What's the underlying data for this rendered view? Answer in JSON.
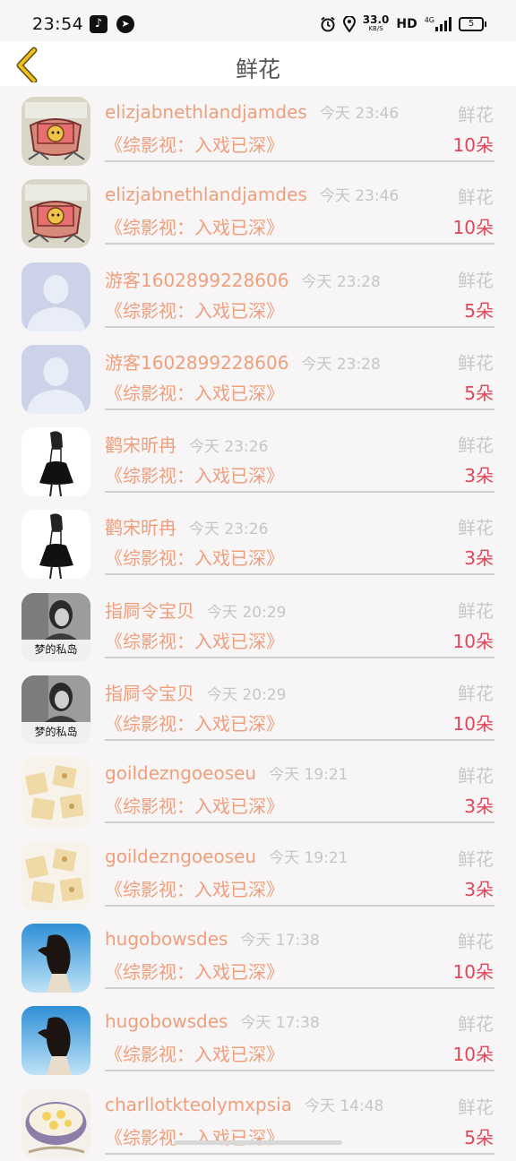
{
  "status_bar": {
    "time": "23:54",
    "net_speed": "33.0",
    "net_unit": "KB/S",
    "hd": "HD",
    "network": "4G",
    "battery": "5"
  },
  "header": {
    "title": "鲜花",
    "back_icon": "chevron-left-icon"
  },
  "rows": [
    {
      "avatar": "cartoon",
      "name": "elizjabnethlandjamdes",
      "time": "今天 23:46",
      "gift": "鲜花",
      "book": "《综影视：入戏已深》",
      "qty": "10朵"
    },
    {
      "avatar": "cartoon",
      "name": "elizjabnethlandjamdes",
      "time": "今天 23:46",
      "gift": "鲜花",
      "book": "《综影视：入戏已深》",
      "qty": "10朵"
    },
    {
      "avatar": "default",
      "name": "游客1602899228606",
      "time": "今天 23:28",
      "gift": "鲜花",
      "book": "《综影视：入戏已深》",
      "qty": "5朵"
    },
    {
      "avatar": "default",
      "name": "游客1602899228606",
      "time": "今天 23:28",
      "gift": "鲜花",
      "book": "《综影视：入戏已深》",
      "qty": "5朵"
    },
    {
      "avatar": "sketch",
      "name": "鹳宋昕冉",
      "time": "今天 23:26",
      "gift": "鲜花",
      "book": "《综影视：入戏已深》",
      "qty": "3朵"
    },
    {
      "avatar": "sketch",
      "name": "鹳宋昕冉",
      "time": "今天 23:26",
      "gift": "鲜花",
      "book": "《综影视：入戏已深》",
      "qty": "3朵"
    },
    {
      "avatar": "photo",
      "avatar_text": "梦的私岛",
      "name": "指屙令宝贝",
      "time": "今天 20:29",
      "gift": "鲜花",
      "book": "《综影视：入戏已深》",
      "qty": "10朵"
    },
    {
      "avatar": "photo",
      "avatar_text": "梦的私岛",
      "name": "指屙令宝贝",
      "time": "今天 20:29",
      "gift": "鲜花",
      "book": "《综影视：入戏已深》",
      "qty": "10朵"
    },
    {
      "avatar": "cookies",
      "name": "goildezngoeoseu",
      "time": "今天 19:21",
      "gift": "鲜花",
      "book": "《综影视：入戏已深》",
      "qty": "3朵"
    },
    {
      "avatar": "cookies",
      "name": "goildezngoeoseu",
      "time": "今天 19:21",
      "gift": "鲜花",
      "book": "《综影视：入戏已深》",
      "qty": "3朵"
    },
    {
      "avatar": "girl",
      "name": "hugobowsdes",
      "time": "今天 17:38",
      "gift": "鲜花",
      "book": "《综影视：入戏已深》",
      "qty": "10朵"
    },
    {
      "avatar": "girl",
      "name": "hugobowsdes",
      "time": "今天 17:38",
      "gift": "鲜花",
      "book": "《综影视：入戏已深》",
      "qty": "10朵"
    },
    {
      "avatar": "food",
      "name": "charllotkteolymxpsia",
      "time": "今天 14:48",
      "gift": "鲜花",
      "book": "《综影视：入戏已深》",
      "qty": "5朵"
    }
  ]
}
